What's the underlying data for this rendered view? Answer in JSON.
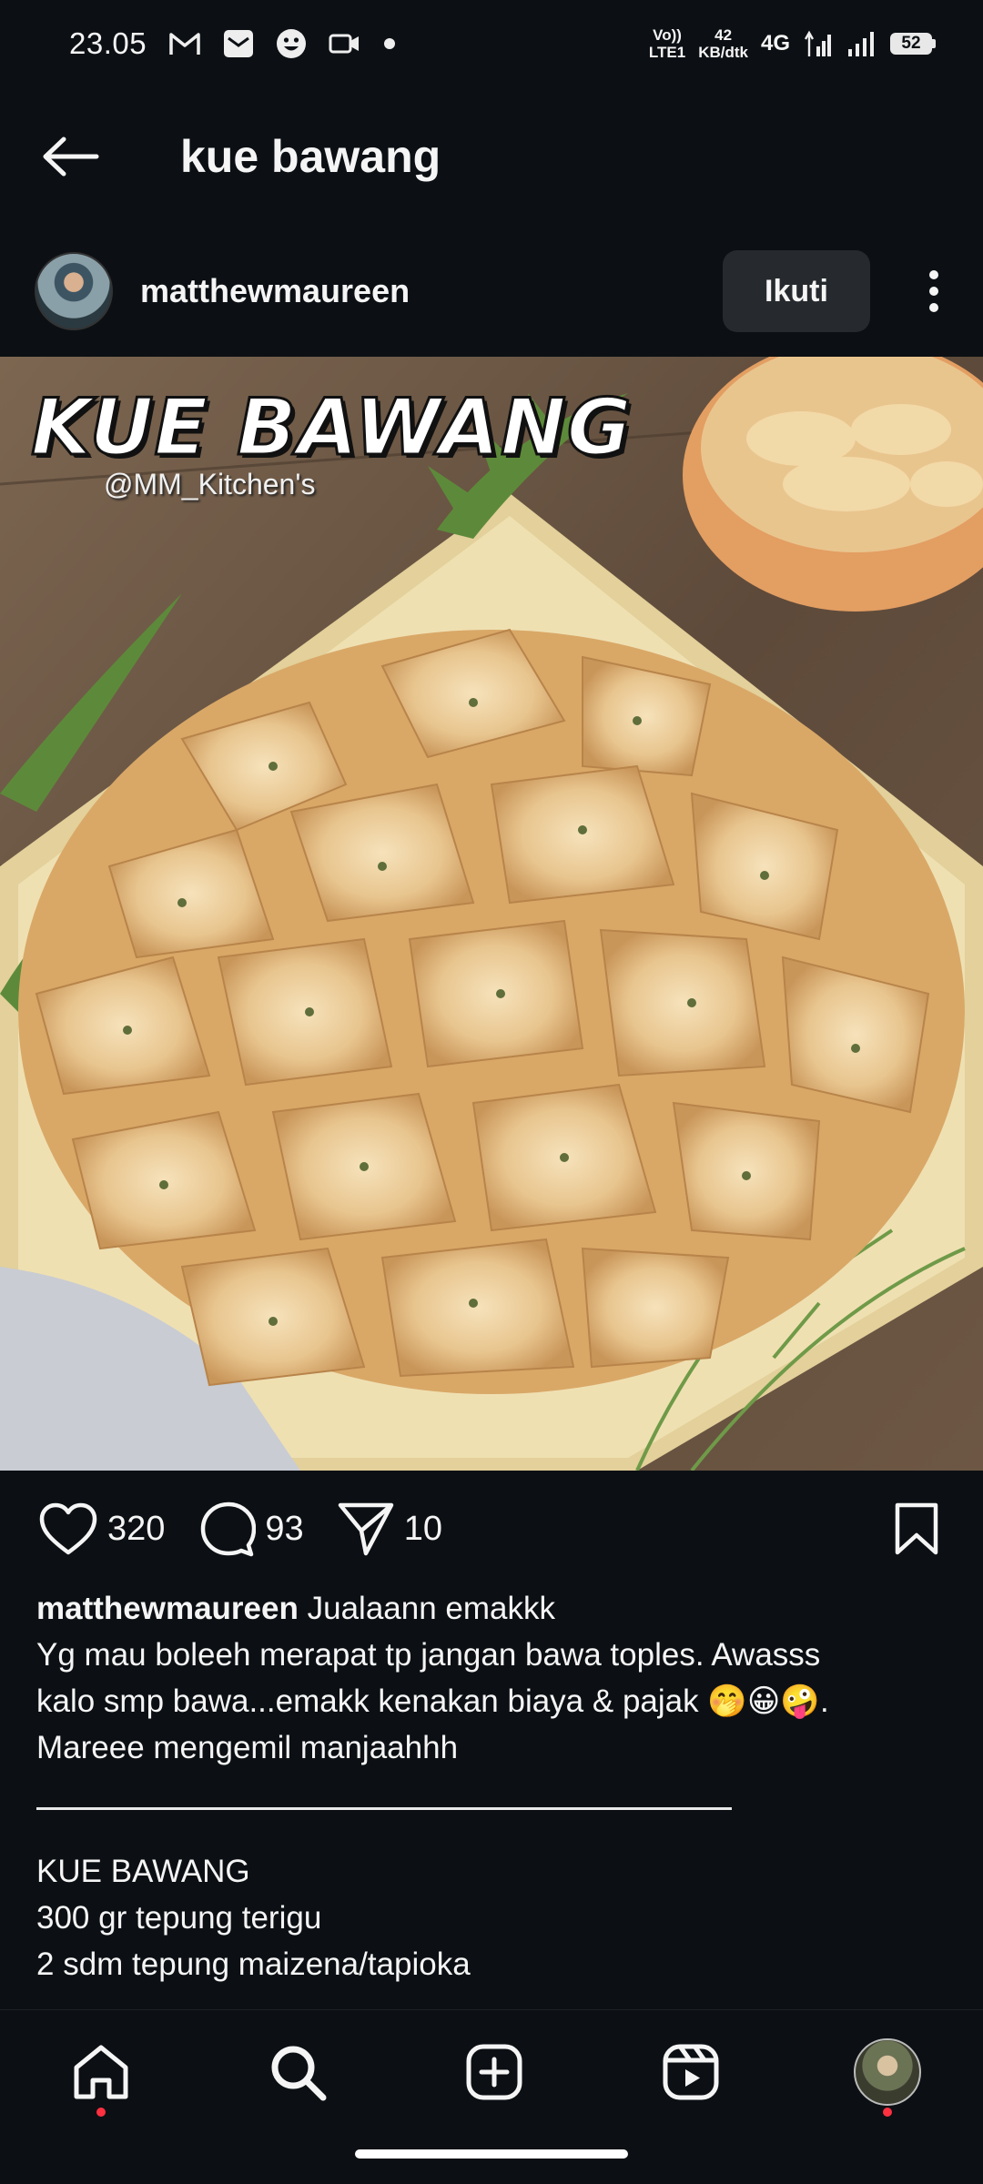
{
  "status_bar": {
    "time": "23.05",
    "volte_top": "Vo))",
    "volte_bottom": "LTE1",
    "speed_value": "42",
    "speed_unit": "KB/dtk",
    "network": "4G",
    "battery": "52"
  },
  "header": {
    "title": "kue bawang"
  },
  "post": {
    "username": "matthewmaureen",
    "follow_label": "Ikuti",
    "image": {
      "overlay_title": "KUE BAWANG",
      "overlay_handle": "@MM_Kitchen's"
    },
    "likes": "320",
    "comments": "93",
    "shares": "10",
    "caption": {
      "username": "matthewmaureen",
      "first_line": "Jualaann emakkk",
      "lines": [
        "Yg mau boleeh merapat tp jangan bawa toples. Awasss",
        "kalo smp bawa...emakk kenakan biaya & pajak 🤭😀🤪.",
        "Mareee mengemil manjaahhh"
      ],
      "recipe_lines": [
        "KUE BAWANG",
        "300 gr tepung terigu",
        "2 sdm tepung maizena/tapioka"
      ]
    }
  },
  "colors": {
    "background": "#0c1014",
    "button_bg": "#262a2e",
    "notification_dot": "#ff3040"
  },
  "icons": {
    "back": "arrow-left-icon",
    "more": "vertical-dots-icon",
    "like": "heart-icon",
    "comment": "speech-bubble-icon",
    "share": "paper-plane-icon",
    "save": "bookmark-icon",
    "home": "home-icon",
    "search": "search-icon",
    "create": "plus-square-icon",
    "reels": "reels-icon"
  }
}
